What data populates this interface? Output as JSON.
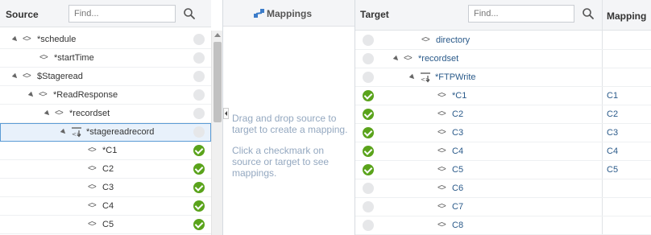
{
  "source": {
    "title": "Source",
    "search_placeholder": "Find...",
    "rows": [
      {
        "label": "*schedule"
      },
      {
        "label": "*startTime"
      },
      {
        "label": "$Stageread"
      },
      {
        "label": "*ReadResponse"
      },
      {
        "label": "*recordset"
      },
      {
        "label": "*stagereadrecord"
      },
      {
        "label": "*C1"
      },
      {
        "label": "C2"
      },
      {
        "label": "C3"
      },
      {
        "label": "C4"
      },
      {
        "label": "C5"
      }
    ]
  },
  "mappings": {
    "title": "Mappings",
    "hint_drag": "Drag and drop source to target to create a mapping.",
    "hint_click": "Click a checkmark on source or target to see mappings."
  },
  "target": {
    "title": "Target",
    "search_placeholder": "Find...",
    "mapping_column": "Mapping",
    "rows": [
      {
        "label": "directory",
        "mapping": ""
      },
      {
        "label": "*recordset",
        "mapping": ""
      },
      {
        "label": "*FTPWrite",
        "mapping": ""
      },
      {
        "label": "*C1",
        "mapping": "C1"
      },
      {
        "label": "C2",
        "mapping": "C2"
      },
      {
        "label": "C3",
        "mapping": "C3"
      },
      {
        "label": "C4",
        "mapping": "C4"
      },
      {
        "label": "C5",
        "mapping": "C5"
      },
      {
        "label": "C6",
        "mapping": ""
      },
      {
        "label": "C7",
        "mapping": ""
      },
      {
        "label": "C8",
        "mapping": ""
      }
    ]
  },
  "colors": {
    "mapped": "#5aa31b",
    "unmapped": "#e6e7e9",
    "selection": "#5b9bd5",
    "link": "#2a5a8a"
  }
}
